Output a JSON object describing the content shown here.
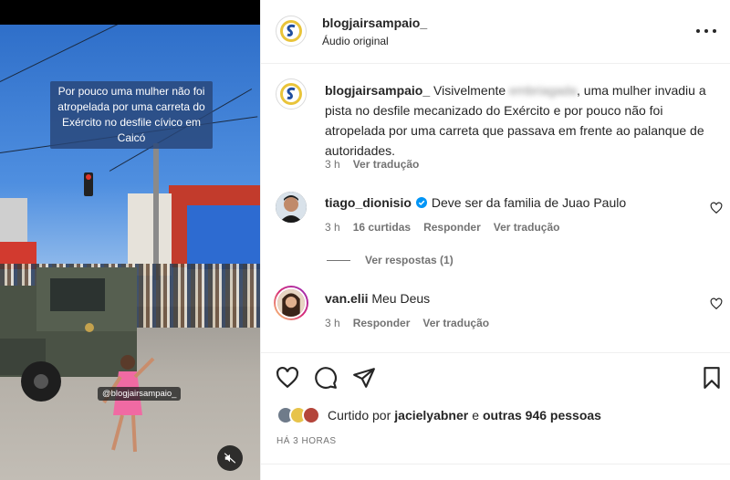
{
  "post": {
    "username": "blogjairsampaio_",
    "audio": "Áudio original",
    "video_caption": "Por pouco uma mulher não foi atropelada por uma carreta do Exército no desfile cívico em Caicó",
    "watermark": "@blogjairsampaio_"
  },
  "caption": {
    "username": "blogjairsampaio_",
    "text_before": "Visivelmente",
    "blurred_word": "embriagada",
    "text_after": ", uma mulher invadiu a pista no desfile mecanizado do Exército e por pouco não foi atropelada por uma carreta que passava em frente ao palanque de autoridades.",
    "time": "3 h",
    "translate": "Ver tradução"
  },
  "comments": [
    {
      "username": "tiago_dionisio",
      "verified": true,
      "text": "Deve ser da familia de Juao Paulo",
      "time": "3 h",
      "likes": "16 curtidas",
      "reply": "Responder",
      "translate": "Ver tradução",
      "view_replies": "Ver respostas (1)"
    },
    {
      "username": "van.elii",
      "verified": false,
      "text": "Meu Deus",
      "time": "3 h",
      "reply": "Responder",
      "translate": "Ver tradução"
    }
  ],
  "likes": {
    "prefix": "Curtido por",
    "user": "jacielyabner",
    "connector": "e",
    "others": "outras 946 pessoas"
  },
  "timestamp": "HÁ 3 HORAS",
  "icons": {
    "like": "heart-icon",
    "comment": "comment-icon",
    "share": "send-icon",
    "save": "bookmark-icon",
    "more": "more-icon",
    "mute": "speaker-muted-icon",
    "verified": "verified-badge-icon"
  },
  "colors": {
    "text": "#262626",
    "secondary": "#737373",
    "verified": "#0095f6",
    "border": "#efefef"
  }
}
